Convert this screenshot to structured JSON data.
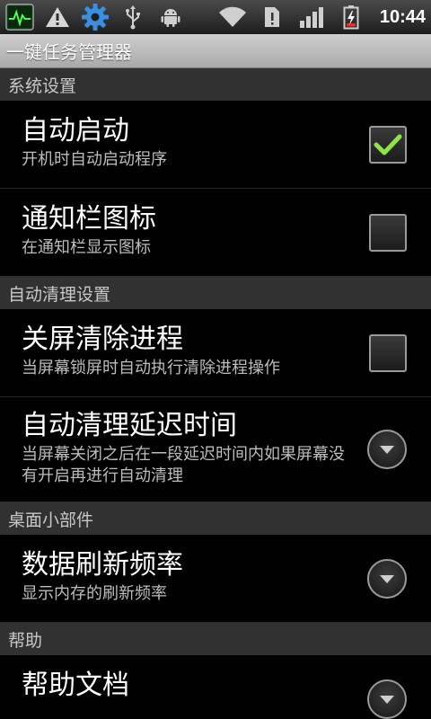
{
  "status_bar": {
    "time": "10:44",
    "left_icons": [
      "activity-monitor-icon",
      "warning-icon",
      "settings-gear-icon",
      "usb-icon",
      "android-debug-icon"
    ],
    "right_icons": [
      "wifi-icon",
      "sim-alert-icon",
      "signal-icon",
      "battery-charging-icon"
    ]
  },
  "title_bar": {
    "title": "一键任务管理器"
  },
  "sections": [
    {
      "header": "系统设置",
      "items": [
        {
          "title": "自动启动",
          "summary": "开机时自动启动程序",
          "widget": "checkbox",
          "checked": true
        },
        {
          "title": "通知栏图标",
          "summary": "在通知栏显示图标",
          "widget": "checkbox",
          "checked": false
        }
      ]
    },
    {
      "header": "自动清理设置",
      "items": [
        {
          "title": "关屏清除进程",
          "summary": "当屏幕锁屏时自动执行清除进程操作",
          "widget": "checkbox",
          "checked": false
        },
        {
          "title": "自动清理延迟时间",
          "summary": "当屏幕关闭之后在一段延迟时间内如果屏幕没有开启再进行自动清理",
          "widget": "dropdown"
        }
      ]
    },
    {
      "header": "桌面小部件",
      "items": [
        {
          "title": "数据刷新频率",
          "summary": "显示内存的刷新频率",
          "widget": "dropdown"
        }
      ]
    },
    {
      "header": "帮助",
      "items": [
        {
          "title": "帮助文档",
          "summary": "",
          "widget": "dropdown"
        }
      ]
    }
  ],
  "colors": {
    "check_mark": "#8ee53f",
    "section_header_bg": "#313131",
    "title_bar_bg": "#b8b8b8"
  }
}
